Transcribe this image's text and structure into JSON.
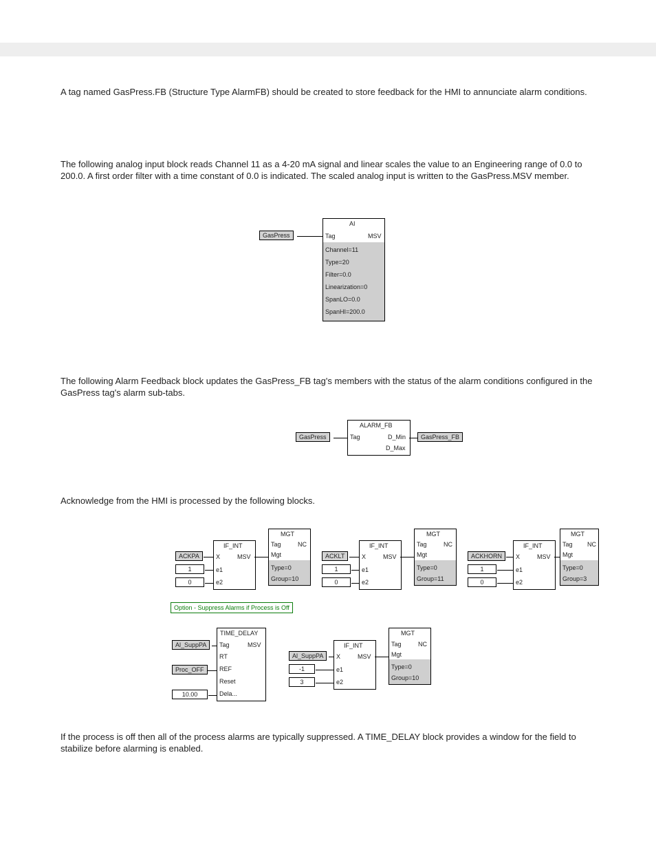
{
  "paragraphs": {
    "p0": "A tag named GasPress.FB (Structure Type AlarmFB) should be created to store feedback for the HMI to annunciate alarm conditions.",
    "p1": "The following analog input block reads Channel 11 as a 4-20 mA signal and linear scales the value to an Engineering range of 0.0 to 200.0.  A first order filter with a time constant of 0.0 is indicated.  The scaled analog input is written to the GasPress.MSV member.",
    "p2": "The following Alarm Feedback block updates the GasPress_FB tag's members with the status of the alarm conditions configured in the GasPress tag's alarm sub-tabs.",
    "p3": "Acknowledge from the HMI is processed by the following blocks.",
    "p4alt": "If the process is off then all of the process alarms are typically suppressed.  A TIME_DELAY block provides a window for the field to stabilize before alarming is enabled."
  },
  "ai": {
    "title": "AI",
    "left": "Tag",
    "right": "MSV",
    "props": [
      "Channel=11",
      "Type=20",
      "Filter=0.0",
      "Linearization=0",
      "SpanLO=0.0",
      "SpanHI=200.0"
    ],
    "src": "GasPress"
  },
  "alarmfb": {
    "title": "ALARM_FB",
    "left": "Tag",
    "r1": "D_Min",
    "r2": "D_Max",
    "src": "GasPress",
    "dst": "GasPress_FB"
  },
  "ifint": {
    "title": "IF_INT",
    "ports": {
      "x": "X",
      "msv": "MSV",
      "e1": "e1",
      "e2": "e2"
    }
  },
  "mgt": {
    "title": "MGT",
    "ports": {
      "tag": "Tag",
      "nc": "NC",
      "mgt": "Mgt"
    },
    "typ0": "Type=0"
  },
  "groups": {
    "g10": "Group=10",
    "g11": "Group=11",
    "g3": "Group=3"
  },
  "labels": {
    "ackpa": "ACKPA",
    "acklt": "ACKLT",
    "ackhorn": "ACKHORN",
    "al_supppa": "Al_SuppPA",
    "proc_off": "Proc_OFF",
    "ten": "10.00",
    "one": "1",
    "zero": "0",
    "neg1": "-1",
    "three": "3"
  },
  "timedelay": {
    "title": "TIME_DELAY",
    "ports": {
      "tag": "Tag",
      "msv": "MSV",
      "rt": "RT",
      "ref": "REF",
      "reset": "Reset",
      "dela": "Dela..."
    }
  },
  "comment": "Option - Suppress Alarms if Process is Off"
}
